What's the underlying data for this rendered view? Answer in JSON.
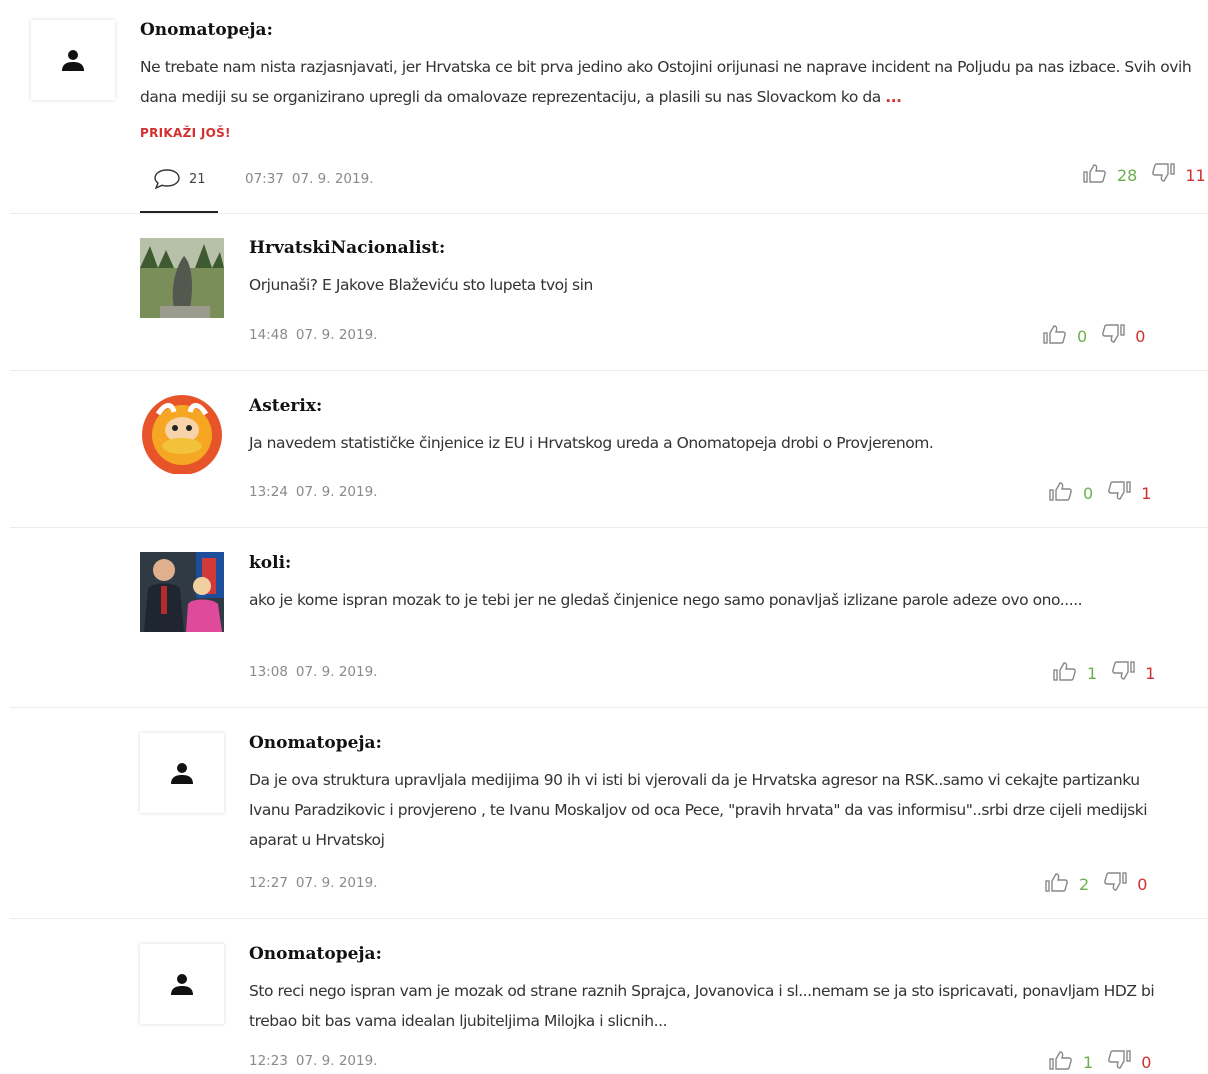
{
  "comments": [
    {
      "author": "Onomatopeja:",
      "text": "Ne trebate nam nista razjasnjavati, jer Hrvatska ce bit prva jedino ako Ostojini orijunasi ne naprave incident na Poljudu pa nas izbace. Svih ovih dana mediji su se organizirano upregli da omalovaze reprezentaciju, a plasili su nas Slovackom ko da",
      "ellipsis": "...",
      "show_more": "PRIKAŽI JOŠ!",
      "reply_count": "21",
      "time": "07:37",
      "date": "07. 9. 2019.",
      "likes": "28",
      "dislikes": "11"
    },
    {
      "author": "HrvatskiNacionalist:",
      "text": "Orjunaši? E Jakove Blaževiću sto lupeta tvoj sin",
      "time": "14:48",
      "date": "07. 9. 2019.",
      "likes": "0",
      "dislikes": "0"
    },
    {
      "author": "Asterix:",
      "text": "Ja navedem statističke činjenice iz EU i Hrvatskog ureda a Onomatopeja drobi o Provjerenom.",
      "time": "13:24",
      "date": "07. 9. 2019.",
      "likes": "0",
      "dislikes": "1"
    },
    {
      "author": "koli:",
      "text": "ako je kome ispran mozak to je tebi jer ne gledaš činjenice nego samo ponavljaš izlizane parole adeze ovo ono.....",
      "time": "13:08",
      "date": "07. 9. 2019.",
      "likes": "1",
      "dislikes": "1"
    },
    {
      "author": "Onomatopeja:",
      "text": "Da je ova struktura upravljala medijima 90 ih vi isti bi vjerovali da je Hrvatska agresor na RSK..samo vi cekajte partizanku Ivanu Paradzikovic i provjereno , te Ivanu Moskaljov od oca Pece, \"pravih hrvata\" da vas informisu\"..srbi drze cijeli medijski aparat u Hrvatskoj",
      "time": "12:27",
      "date": "07. 9. 2019.",
      "likes": "2",
      "dislikes": "0"
    },
    {
      "author": "Onomatopeja:",
      "text": "Sto reci nego ispran vam je mozak od strane raznih Sprajca, Jovanovica i sl...nemam se ja sto ispricavati, ponavljam HDZ bi trebao bit bas vama idealan ljubiteljima Milojka i slicnih...",
      "time": "12:23",
      "date": "07. 9. 2019.",
      "likes": "1",
      "dislikes": "0"
    }
  ],
  "colors": {
    "like": "#6ab04c",
    "dislike": "#d0302f",
    "accent": "#d0302f"
  },
  "icons": {
    "avatar": "user-icon",
    "replies": "speech-bubble-icon",
    "like": "thumbs-up-icon",
    "dislike": "thumbs-down-icon"
  }
}
